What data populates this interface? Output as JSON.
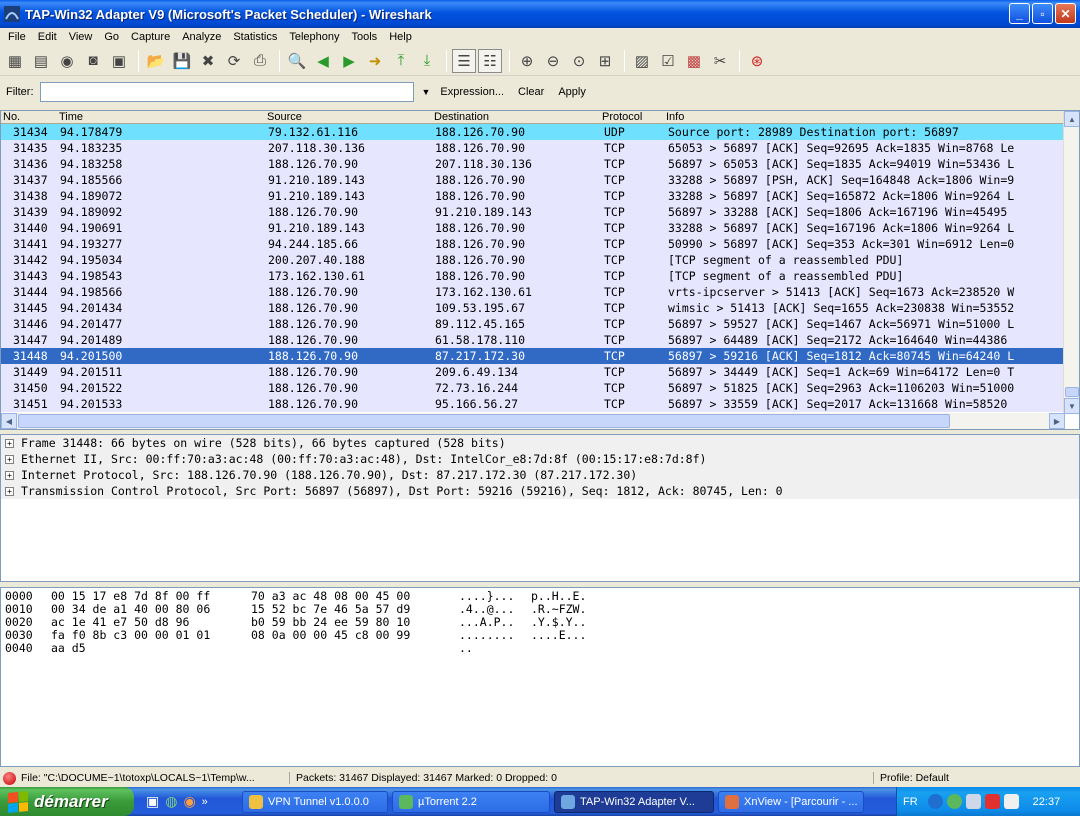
{
  "window": {
    "title": "TAP-Win32 Adapter V9 (Microsoft's Packet Scheduler)  - Wireshark"
  },
  "menu": [
    "File",
    "Edit",
    "View",
    "Go",
    "Capture",
    "Analyze",
    "Statistics",
    "Telephony",
    "Tools",
    "Help"
  ],
  "filter": {
    "label": "Filter:",
    "value": "",
    "expression": "Expression...",
    "clear": "Clear",
    "apply": "Apply"
  },
  "columns": {
    "no": "No.",
    "time": "Time",
    "source": "Source",
    "destination": "Destination",
    "protocol": "Protocol",
    "info": "Info"
  },
  "packets": [
    {
      "no": "31434",
      "time": "94.178479",
      "src": "79.132.61.116",
      "dst": "188.126.70.90",
      "proto": "UDP",
      "info": "Source port: 28989  Destination port: 56897"
    },
    {
      "no": "31435",
      "time": "94.183235",
      "src": "207.118.30.136",
      "dst": "188.126.70.90",
      "proto": "TCP",
      "info": "65053 > 56897 [ACK] Seq=92695 Ack=1835 Win=8768 Le"
    },
    {
      "no": "31436",
      "time": "94.183258",
      "src": "188.126.70.90",
      "dst": "207.118.30.136",
      "proto": "TCP",
      "info": "56897 > 65053 [ACK] Seq=1835 Ack=94019 Win=53436 L"
    },
    {
      "no": "31437",
      "time": "94.185566",
      "src": "91.210.189.143",
      "dst": "188.126.70.90",
      "proto": "TCP",
      "info": "33288 > 56897 [PSH, ACK] Seq=164848 Ack=1806 Win=9"
    },
    {
      "no": "31438",
      "time": "94.189072",
      "src": "91.210.189.143",
      "dst": "188.126.70.90",
      "proto": "TCP",
      "info": "33288 > 56897 [ACK] Seq=165872 Ack=1806 Win=9264 L"
    },
    {
      "no": "31439",
      "time": "94.189092",
      "src": "188.126.70.90",
      "dst": "91.210.189.143",
      "proto": "TCP",
      "info": "56897 > 33288 [ACK] Seq=1806 Ack=167196 Win=45495"
    },
    {
      "no": "31440",
      "time": "94.190691",
      "src": "91.210.189.143",
      "dst": "188.126.70.90",
      "proto": "TCP",
      "info": "33288 > 56897 [ACK] Seq=167196 Ack=1806 Win=9264 L"
    },
    {
      "no": "31441",
      "time": "94.193277",
      "src": "94.244.185.66",
      "dst": "188.126.70.90",
      "proto": "TCP",
      "info": "50990 > 56897 [ACK] Seq=353 Ack=301 Win=6912 Len=0"
    },
    {
      "no": "31442",
      "time": "94.195034",
      "src": "200.207.40.188",
      "dst": "188.126.70.90",
      "proto": "TCP",
      "info": "[TCP segment of a reassembled PDU]"
    },
    {
      "no": "31443",
      "time": "94.198543",
      "src": "173.162.130.61",
      "dst": "188.126.70.90",
      "proto": "TCP",
      "info": "[TCP segment of a reassembled PDU]"
    },
    {
      "no": "31444",
      "time": "94.198566",
      "src": "188.126.70.90",
      "dst": "173.162.130.61",
      "proto": "TCP",
      "info": "vrts-ipcserver > 51413 [ACK] Seq=1673 Ack=238520 W"
    },
    {
      "no": "31445",
      "time": "94.201434",
      "src": "188.126.70.90",
      "dst": "109.53.195.67",
      "proto": "TCP",
      "info": "wimsic > 51413 [ACK] Seq=1655 Ack=230838 Win=53552"
    },
    {
      "no": "31446",
      "time": "94.201477",
      "src": "188.126.70.90",
      "dst": "89.112.45.165",
      "proto": "TCP",
      "info": "56897 > 59527 [ACK] Seq=1467 Ack=56971 Win=51000 L"
    },
    {
      "no": "31447",
      "time": "94.201489",
      "src": "188.126.70.90",
      "dst": "61.58.178.110",
      "proto": "TCP",
      "info": "56897 > 64489 [ACK] Seq=2172 Ack=164640 Win=44386"
    },
    {
      "no": "31448",
      "time": "94.201500",
      "src": "188.126.70.90",
      "dst": "87.217.172.30",
      "proto": "TCP",
      "info": "56897 > 59216 [ACK] Seq=1812 Ack=80745 Win=64240 L"
    },
    {
      "no": "31449",
      "time": "94.201511",
      "src": "188.126.70.90",
      "dst": "209.6.49.134",
      "proto": "TCP",
      "info": "56897 > 34449 [ACK] Seq=1 Ack=69 Win=64172 Len=0 T"
    },
    {
      "no": "31450",
      "time": "94.201522",
      "src": "188.126.70.90",
      "dst": "72.73.16.244",
      "proto": "TCP",
      "info": "56897 > 51825 [ACK] Seq=2963 Ack=1106203 Win=51000"
    },
    {
      "no": "31451",
      "time": "94.201533",
      "src": "188.126.70.90",
      "dst": "95.166.56.27",
      "proto": "TCP",
      "info": "56897 > 33559 [ACK] Seq=2017 Ack=131668 Win=58520"
    }
  ],
  "details": [
    "Frame 31448: 66 bytes on wire (528 bits), 66 bytes captured (528 bits)",
    "Ethernet II, Src: 00:ff:70:a3:ac:48 (00:ff:70:a3:ac:48), Dst: IntelCor_e8:7d:8f (00:15:17:e8:7d:8f)",
    "Internet Protocol, Src: 188.126.70.90 (188.126.70.90), Dst: 87.217.172.30 (87.217.172.30)",
    "Transmission Control Protocol, Src Port: 56897 (56897), Dst Port: 59216 (59216), Seq: 1812, Ack: 80745, Len: 0"
  ],
  "bytes": [
    {
      "off": "0000",
      "hex1": "00 15 17 e8 7d 8f 00 ff",
      "hex2": "70 a3 ac 48 08 00 45 00",
      "a1": "....}...",
      "a2": "p..H..E."
    },
    {
      "off": "0010",
      "hex1": "00 34 de a1 40 00 80 06",
      "hex2": "15 52 bc 7e 46 5a 57 d9",
      "a1": ".4..@...",
      "a2": ".R.~FZW."
    },
    {
      "off": "0020",
      "hex1": "ac 1e 41 e7 50 d8 96",
      "hex2": "b0 59 bb 24 ee 59 80 10",
      "a1": "...A.P..",
      "a2": ".Y.$.Y.."
    },
    {
      "off": "0030",
      "hex1": "fa f0 8b c3 00 00 01 01",
      "hex2": "08 0a 00 00 45 c8 00 99",
      "a1": "........",
      "a2": "....E..."
    },
    {
      "off": "0040",
      "hex1": "aa d5",
      "hex2": "",
      "a1": "..",
      "a2": ""
    }
  ],
  "status": {
    "file": "File: \"C:\\DOCUME~1\\totoxp\\LOCALS~1\\Temp\\w...",
    "packets": "Packets: 31467 Displayed: 31467 Marked: 0 Dropped: 0",
    "profile": "Profile: Default"
  },
  "taskbar": {
    "start": "démarrer",
    "tasks": [
      "VPN Tunnel v1.0.0.0",
      "µTorrent 2.2",
      "TAP-Win32 Adapter V...",
      "XnView - [Parcourir - ..."
    ],
    "lang": "FR",
    "clock": "22:37"
  },
  "colors": {
    "udp_row": "#70e0ff",
    "tcp_row": "#e7e6ff",
    "selected_row": "#316ac5"
  }
}
